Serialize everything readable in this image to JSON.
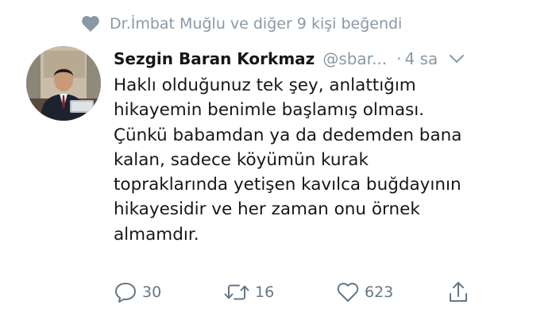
{
  "social_context": {
    "icon": "heart-icon",
    "text": "Dr.İmbat Muğlu ve diğer 9 kişi beğendi"
  },
  "tweet": {
    "author_name": "Sezgin Baran Korkmaz",
    "author_handle": "@sbar...",
    "separator": "·",
    "time": "4 sa",
    "text_lines": [
      "Haklı olduğunuz tek şey, anlattığım",
      "hikayemin benimle başlamış olması.",
      "Çünkü babamdan ya da dedemden bana",
      "kalan, sadece köyümün kurak",
      "topraklarında yetişen kavılca buğdayının",
      "hikayesidir ve her zaman onu örnek",
      "almamdır."
    ]
  },
  "actions": {
    "reply": {
      "icon": "reply-icon",
      "count": "30"
    },
    "retweet": {
      "icon": "retweet-icon",
      "count": "16"
    },
    "like": {
      "icon": "heart-icon",
      "count": "623"
    },
    "share": {
      "icon": "share-icon"
    }
  },
  "colors": {
    "text": "#14171a",
    "secondary": "#8899a6",
    "action": "#657786"
  }
}
